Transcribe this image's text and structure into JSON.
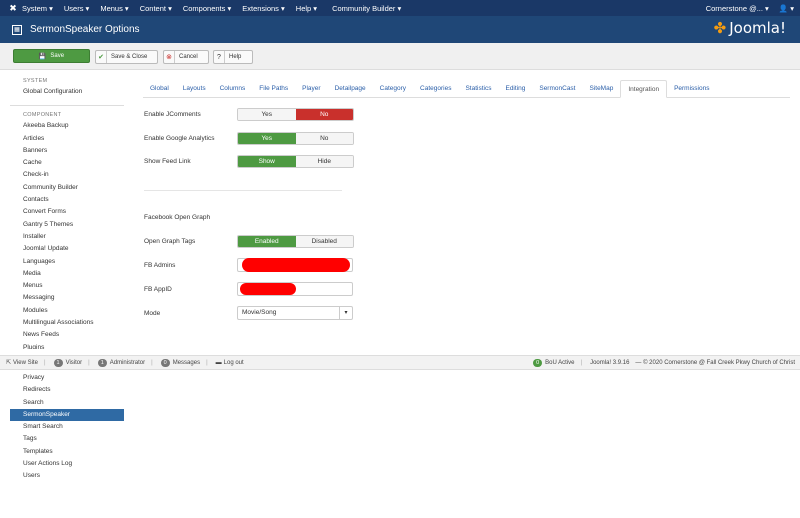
{
  "topnav": {
    "menus": [
      "System",
      "Users",
      "Menus",
      "Content",
      "Components",
      "Extensions",
      "Help",
      "Community Builder"
    ],
    "user_site": "Cornerstone @...",
    "user_icon": "user-icon"
  },
  "header": {
    "title": "SermonSpeaker Options",
    "logo_text": "Joomla!"
  },
  "toolbar": {
    "save": "Save",
    "save_close": "Save & Close",
    "cancel": "Cancel",
    "help": "Help"
  },
  "sidebar": {
    "system_heading": "SYSTEM",
    "global_config": "Global Configuration",
    "component_heading": "COMPONENT",
    "items": [
      "Akeeba Backup",
      "Articles",
      "Banners",
      "Cache",
      "Check-in",
      "Community Builder",
      "Contacts",
      "Convert Forms",
      "Gantry 5 Themes",
      "Installer",
      "Joomla! Update",
      "Languages",
      "Media",
      "Menus",
      "Messaging",
      "Modules",
      "Multilingual Associations",
      "News Feeds",
      "Plugins",
      "Privacy",
      "Redirects",
      "Search",
      "SermonSpeaker",
      "Smart Search",
      "Tags",
      "Templates",
      "User Actions Log",
      "Users"
    ],
    "active_index": 22
  },
  "tabs": {
    "items": [
      "Global",
      "Layouts",
      "Columns",
      "File Paths",
      "Player",
      "Detailpage",
      "Category",
      "Categories",
      "Statistics",
      "Editing",
      "SermonCast",
      "SiteMap",
      "Integration",
      "Permissions"
    ],
    "active_index": 12
  },
  "form": {
    "jcomments_label": "Enable JComments",
    "jcomments_yes": "Yes",
    "jcomments_no": "No",
    "analytics_label": "Enable Google Analytics",
    "analytics_yes": "Yes",
    "analytics_no": "No",
    "feed_label": "Show Feed Link",
    "feed_show": "Show",
    "feed_hide": "Hide",
    "og_heading": "Facebook Open Graph",
    "og_tags_label": "Open Graph Tags",
    "og_enabled": "Enabled",
    "og_disabled": "Disabled",
    "fb_admins_label": "FB Admins",
    "fb_appid_label": "FB AppID",
    "mode_label": "Mode",
    "mode_value": "Movie/Song"
  },
  "statusbar": {
    "view_site": "View Site",
    "visitor_count": "1",
    "visitor_label": "Visitor",
    "admin_count": "1",
    "admin_label": "Administrator",
    "messages_count": "0",
    "messages_label": "Messages",
    "logout": "Log out",
    "bou_count": "0",
    "bou_label": "BoU Active",
    "version": "Joomla! 3.9.16",
    "copyright": "— © 2020 Cornerstone @ Fall Creek Pkwy Church of Christ"
  },
  "colors": {
    "topnav_bg": "#1a3867",
    "header_bg": "#1f4777",
    "success": "#4e9a42",
    "danger": "#c9302c",
    "active_sidebar": "#2f6aa4",
    "link": "#2a5ea8"
  }
}
